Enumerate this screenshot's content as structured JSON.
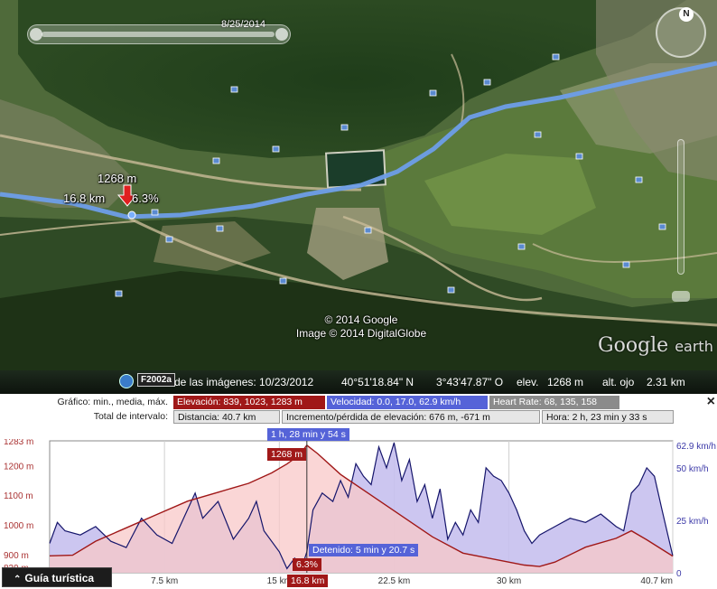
{
  "map": {
    "date_label": "8/25/2014",
    "marker": {
      "elevation": "1268 m",
      "distance": "16.8 km",
      "grade": "6.3%"
    },
    "copyright_line1": "© 2014 Google",
    "copyright_line2": "Image © 2014 DigitalGlobe",
    "logo_word": "Google",
    "logo_sub": "earth",
    "compass_letter": "N"
  },
  "status": {
    "badge": "F2002a",
    "imagery_date": "de las imágenes: 10/23/2012",
    "latitude": "40°51'18.84\" N",
    "longitude": "3°43'47.87\" O",
    "elev_label": "elev.",
    "elev_value": "1268 m",
    "eye_label": "alt. ojo",
    "eye_value": "2.31 km"
  },
  "stats": {
    "graph_label": "Gráfico: min., media, máx.",
    "elevation": "Elevación: 839, 1023, 1283 m",
    "speed": "Velocidad: 0.0, 17.0, 62.9 km/h",
    "heart_rate": "Heart Rate: 68, 135, 158",
    "interval_label": "Total de intervalo:",
    "distance": "Distancia: 40.7 km",
    "gain_loss": "Incremento/pérdida de elevación: 676 m, -671 m",
    "time": "Hora: 2 h, 23 min y 33 s",
    "close": "×"
  },
  "profile": {
    "time_tag": "1 h, 28 min y 54 s",
    "elev_tag": "1268 m",
    "stop_tag": "Detenido: 5 min y 20.7 s",
    "grade_tag": "6.3%",
    "dist_tag": "16.8 km",
    "tour_button": "Guía turística",
    "tour_chevron": "⌃"
  },
  "chart_data": {
    "type": "area",
    "x_unit": "km",
    "xlim": [
      0,
      40.7
    ],
    "x_ticks": [
      "7.5 km",
      "15 km",
      "22.5 km",
      "30 km",
      "40.7 km"
    ],
    "y_left_ticks": [
      "1283 m",
      "1200 m",
      "1100 m",
      "1000 m",
      "900 m",
      "839 m"
    ],
    "y_left_lim": [
      839,
      1283
    ],
    "y_right_ticks": [
      "62.9 km/h",
      "50 km/h",
      "25 km/h",
      "0"
    ],
    "y_right_lim": [
      0,
      62.9
    ],
    "cursor_x": 16.8,
    "series": [
      {
        "name": "Elevación",
        "color": "#a01818",
        "fill": "#f8c8c8",
        "x": [
          0,
          1.5,
          3,
          5,
          7,
          9,
          11,
          13,
          14.5,
          15.5,
          16.3,
          16.8,
          17.5,
          19,
          21,
          23,
          25,
          27,
          29,
          31,
          32,
          33,
          35,
          37,
          38,
          39,
          40.7
        ],
        "values": [
          896,
          898,
          945,
          990,
          1035,
          1080,
          1110,
          1140,
          1175,
          1205,
          1235,
          1268,
          1240,
          1170,
          1100,
          1030,
          960,
          905,
          885,
          865,
          860,
          875,
          925,
          955,
          980,
          950,
          895
        ]
      },
      {
        "name": "Velocidad",
        "color": "#15156b",
        "fill": "#c6c0ee",
        "x": [
          0,
          0.5,
          1,
          2,
          3,
          4,
          5,
          6,
          7,
          8,
          9,
          9.5,
          10,
          11,
          12,
          13,
          13.5,
          14,
          15,
          15.5,
          16,
          16.5,
          16.8,
          17.2,
          17.8,
          18.5,
          19,
          19.5,
          20,
          20.5,
          21,
          21.5,
          22,
          22.5,
          23,
          23.5,
          24,
          24.5,
          25,
          25.5,
          26,
          26.5,
          27,
          27.5,
          28,
          28.5,
          29,
          29.5,
          30,
          30.5,
          31,
          31.5,
          32,
          33,
          34,
          35,
          36,
          37,
          37.5,
          38,
          38.5,
          39,
          39.5,
          40,
          40.7
        ],
        "values": [
          14,
          24,
          20,
          18,
          22,
          15,
          12,
          26,
          18,
          14,
          30,
          38,
          26,
          34,
          16,
          26,
          34,
          20,
          10,
          2,
          7,
          3,
          10,
          30,
          38,
          34,
          44,
          36,
          52,
          46,
          42,
          60,
          50,
          62,
          44,
          54,
          34,
          42,
          26,
          40,
          16,
          24,
          18,
          30,
          24,
          50,
          46,
          44,
          38,
          30,
          20,
          14,
          18,
          22,
          26,
          24,
          28,
          22,
          20,
          38,
          42,
          50,
          46,
          30,
          8
        ]
      }
    ]
  }
}
